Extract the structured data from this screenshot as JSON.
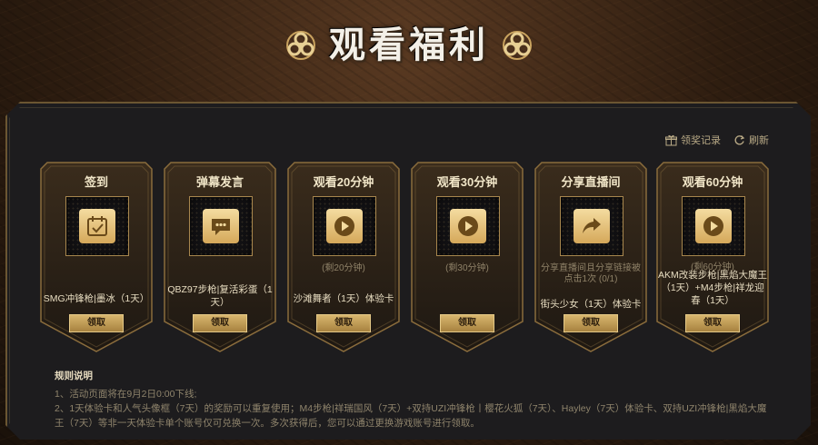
{
  "header": {
    "title": "观看福利"
  },
  "toolbar": {
    "records_label": "领奖记录",
    "refresh_label": "刷新"
  },
  "cards": [
    {
      "title": "签到",
      "icon": "calendar-check-icon",
      "progress": "",
      "reward": "SMG冲锋枪|墨冰（1天）",
      "button": "领取"
    },
    {
      "title": "弹幕发言",
      "icon": "chat-bubble-icon",
      "progress": "",
      "reward": "QBZ97步枪|复活彩蛋（1天）",
      "button": "领取"
    },
    {
      "title": "观看20分钟",
      "icon": "play-icon",
      "progress": "(剩20分钟)",
      "reward": "沙滩舞者（1天）体验卡",
      "button": "领取"
    },
    {
      "title": "观看30分钟",
      "icon": "play-icon",
      "progress": "(剩30分钟)",
      "reward": "",
      "button": "领取"
    },
    {
      "title": "分享直播间",
      "icon": "share-arrow-icon",
      "progress": "分享直播间且分享链接被点击1次 (0/1)",
      "reward": "街头少女（1天）体验卡",
      "button": "领取"
    },
    {
      "title": "观看60分钟",
      "icon": "play-icon",
      "progress": "(剩60分钟)",
      "reward": "AKM改装步枪|黑焰大魔王（1天）+M4步枪|祥龙迎春（1天）",
      "button": "领取"
    }
  ],
  "rules": {
    "title": "规则说明",
    "line1": "1、活动页面将在9月2日0:00下线;",
    "line2": "2、1天体验卡和人气头像框（7天）的奖励可以重复使用；M4步枪|祥瑞国风（7天）+双持UZI冲锋枪丨樱花火狐（7天）、Hayley（7天）体验卡、双持UZI冲锋枪|黑焰大魔王（7天）等非一天体验卡单个账号仅可兑换一次。多次获得后，您可以通过更换游戏账号进行领取。"
  },
  "colors": {
    "accent": "#d8b66e",
    "panel": "#1d1c1e",
    "border": "#6b5632"
  }
}
